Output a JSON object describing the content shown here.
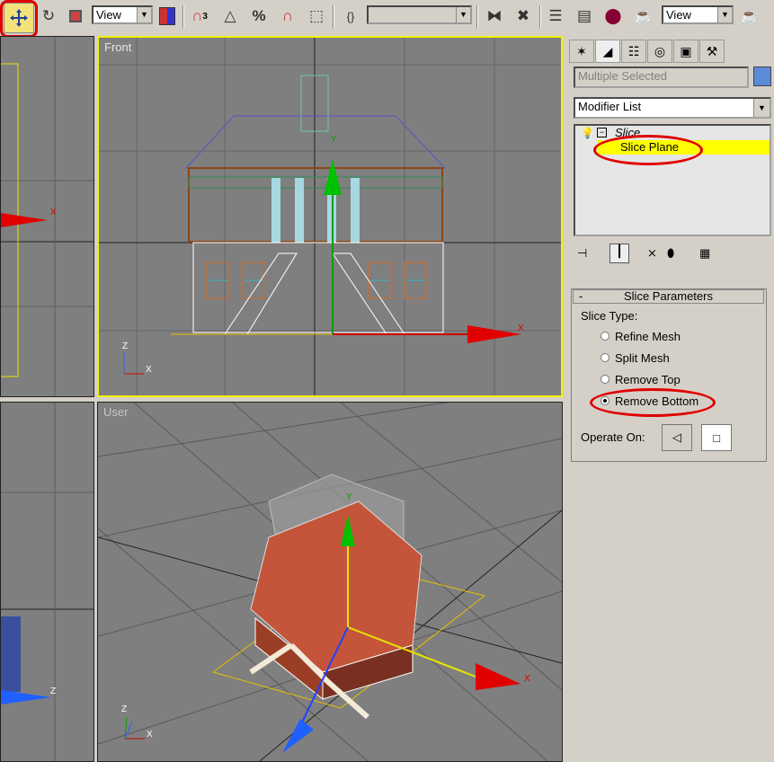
{
  "toolbar": {
    "view_dropdown_1": "View",
    "view_dropdown_2": "View",
    "selection_set": "",
    "icons": [
      "select-move-icon",
      "select-rotate-icon",
      "select-scale-icon",
      "select-link-icon",
      "snap-3d-icon",
      "angle-snap-icon",
      "percent-snap-icon",
      "spinner-snap-icon",
      "named-selection-icon",
      "mirror-icon",
      "align-icon",
      "track-view-icon",
      "schematic-view-icon",
      "material-editor-icon",
      "render-scene-icon",
      "quick-render-icon"
    ],
    "snap_label": "3",
    "percent_label": "%"
  },
  "viewports": {
    "front_label": "Front",
    "user_label": "User",
    "axis_x": "X",
    "axis_y": "Y",
    "axis_z": "Z"
  },
  "command_panel": {
    "tabs": [
      "create-tab",
      "modify-tab",
      "hierarchy-tab",
      "motion-tab",
      "display-tab",
      "utilities-tab"
    ],
    "name_field": "Multiple Selected",
    "modifier_list": "Modifier List",
    "stack": {
      "item_1": "Slice",
      "item_2": "Slice Plane"
    },
    "rollout": {
      "collapse": "-",
      "title": "Slice Parameters",
      "slice_type_label": "Slice Type:",
      "options": [
        "Refine Mesh",
        "Split Mesh",
        "Remove Top",
        "Remove Bottom"
      ],
      "selected_index": 3,
      "operate_on_label": "Operate On:"
    }
  },
  "colors": {
    "highlight_yellow": "#ffff00",
    "annotation_red": "#e00000",
    "viewport_gray": "#7f7f7f",
    "ui_gray": "#d4d0c8",
    "brand_blue": "#5b8ad6"
  }
}
